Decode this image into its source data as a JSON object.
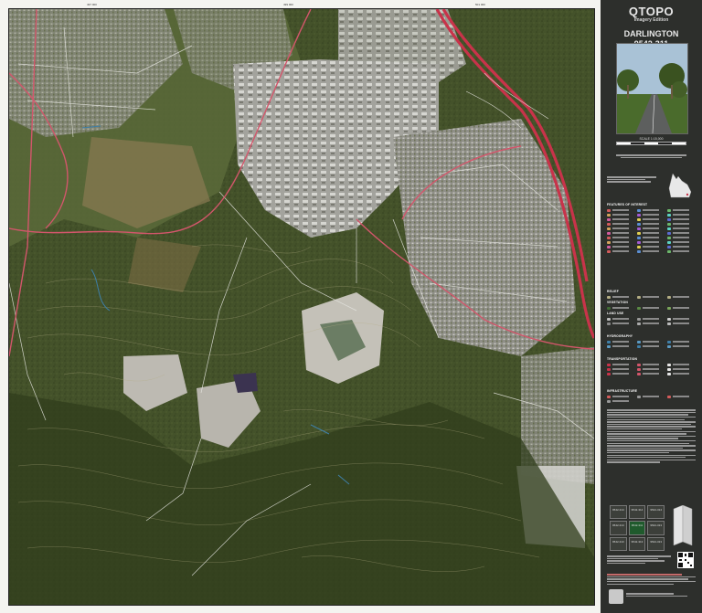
{
  "sheet": {
    "brand": "QTOPO",
    "edition": "Imagery Edition",
    "map_name": "DARLINGTON",
    "map_number": "9542-311",
    "scale_label": "SCALE 1:15,000"
  },
  "colors": {
    "panel_bg": "#2d2f2c",
    "motorway": "#c8334a",
    "road_main": "#d2566b",
    "road_minor": "#e6e6e6",
    "vegetation_dark": "#34421f",
    "vegetation_mid": "#52602f",
    "urban": "#9a9a94",
    "quarry": "#bfbcb4",
    "contour": "#b7b08a",
    "water": "#3e7fa8"
  },
  "legend": {
    "features_of_interest": "FEATURES OF INTEREST",
    "relief": "RELIEF",
    "vegetation": "VEGETATION",
    "landuse": "LAND USE",
    "hydrography": "HYDROGRAPHY",
    "transportation": "TRANSPORTATION",
    "infrastructure": "INFRASTRUCTURE"
  },
  "adjoining_sheets": [
    {
      "id": "9542-314",
      "current": false
    },
    {
      "id": "9542-314",
      "current": false
    },
    {
      "id": "9542-314",
      "current": false
    },
    {
      "id": "9542-314",
      "current": false
    },
    {
      "id": "9542-311",
      "current": true
    },
    {
      "id": "9542-313",
      "current": false
    },
    {
      "id": "9542-313",
      "current": false
    },
    {
      "id": "9542-313",
      "current": false
    },
    {
      "id": "9542-313",
      "current": false
    }
  ],
  "icons": {
    "qr_code": "qr-code-icon",
    "crest": "queensland-crest-icon",
    "locator": "queensland-locator-map"
  }
}
